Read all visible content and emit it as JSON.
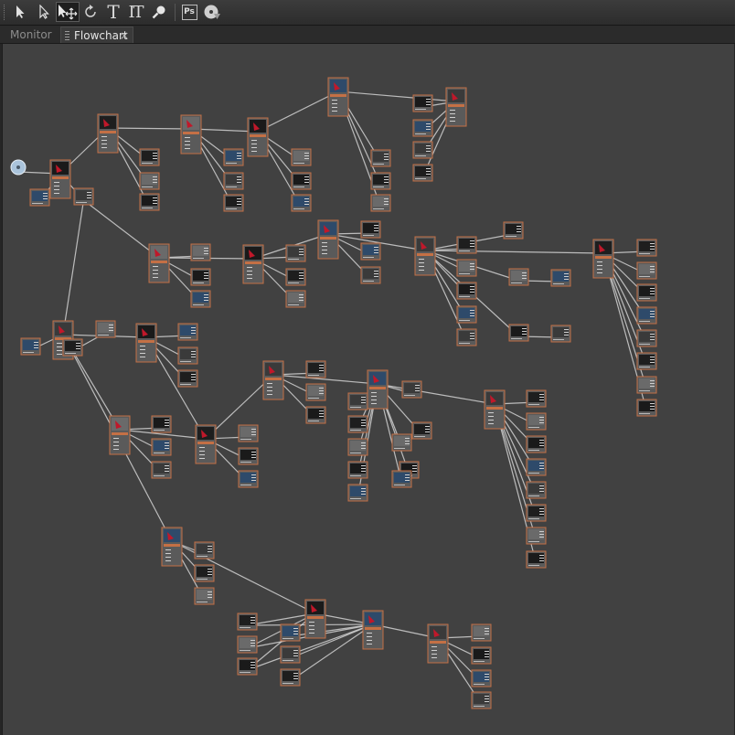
{
  "toolbar": {
    "tools": [
      {
        "name": "selection-tool",
        "icon": "arrow-icon"
      },
      {
        "name": "direct-selection-tool",
        "icon": "hollow-arrow-icon"
      },
      {
        "name": "move-tool",
        "icon": "move-arrow-icon",
        "active": true
      },
      {
        "name": "rotate-tool",
        "icon": "rotate-icon"
      },
      {
        "name": "text-tool",
        "icon": "text-icon",
        "glyph": "T"
      },
      {
        "name": "vertical-text-tool",
        "icon": "vertical-text-icon",
        "glyph": "IT"
      },
      {
        "name": "zoom-tool",
        "icon": "magnifier-icon"
      },
      {
        "name": "photoshop-tool",
        "icon": "ps-icon",
        "glyph": "Ps"
      },
      {
        "name": "render-tool",
        "icon": "render-disc-icon"
      }
    ]
  },
  "tabs": {
    "monitor": "Monitor",
    "flowchart": "Flowchart",
    "close_glyph": "×"
  },
  "colors": {
    "canvas": "#414141",
    "node_border": "#c47045",
    "node_body": "#5a5a5a",
    "wire": "#d2d2d2"
  }
}
